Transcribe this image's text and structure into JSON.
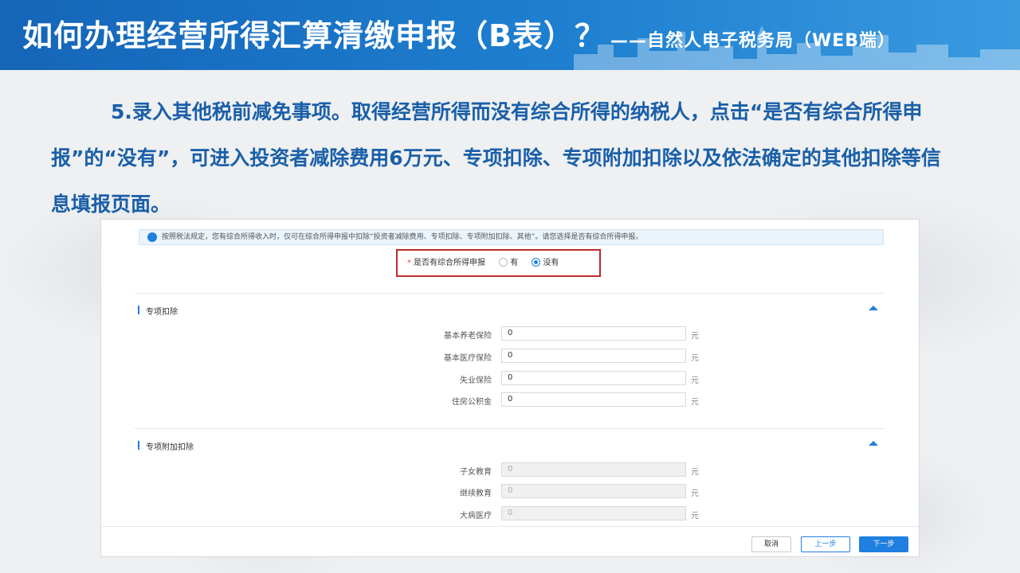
{
  "header": {
    "title": "如何办理经营所得汇算清缴申报（B表）？",
    "subtitle": "——自然人电子税务局（WEB端）"
  },
  "intro": {
    "text": "5.录入其他税前减免事项。取得经营所得而没有综合所得的纳税人，点击“是否有综合所得申报”的“没有”，可进入投资者减除费用6万元、专项扣除、专项附加扣除以及依法确定的其他扣除等信息填报页面。"
  },
  "form": {
    "notice": "按照税法规定，您有综合所得收入时，仅可在综合所得申报中扣除“投资者减除费用、专项扣除、专项附加扣除、其他”。请您选择是否有综合所得申报。",
    "question": {
      "required_mark": "*",
      "label": "是否有综合所得申报",
      "options": [
        "有",
        "没有"
      ],
      "selected": "没有"
    },
    "sections": [
      {
        "title": "专项扣除",
        "fields": [
          {
            "label": "基本养老保险",
            "value": "0",
            "unit": "元"
          },
          {
            "label": "基本医疗保险",
            "value": "0",
            "unit": "元"
          },
          {
            "label": "失业保险",
            "value": "0",
            "unit": "元"
          },
          {
            "label": "住房公积金",
            "value": "0",
            "unit": "元"
          }
        ]
      },
      {
        "title": "专项附加扣除",
        "fields": [
          {
            "label": "子女教育",
            "value": "0",
            "unit": "元"
          },
          {
            "label": "继续教育",
            "value": "0",
            "unit": "元"
          },
          {
            "label": "大病医疗",
            "value": "0",
            "unit": "元"
          }
        ]
      }
    ],
    "buttons": {
      "cancel": "取消",
      "prev": "上一步",
      "next": "下一步"
    },
    "colors": {
      "accent": "#1f7fe0",
      "highlight_box": "#c0282a",
      "heading_text": "#1a5fa8"
    }
  }
}
